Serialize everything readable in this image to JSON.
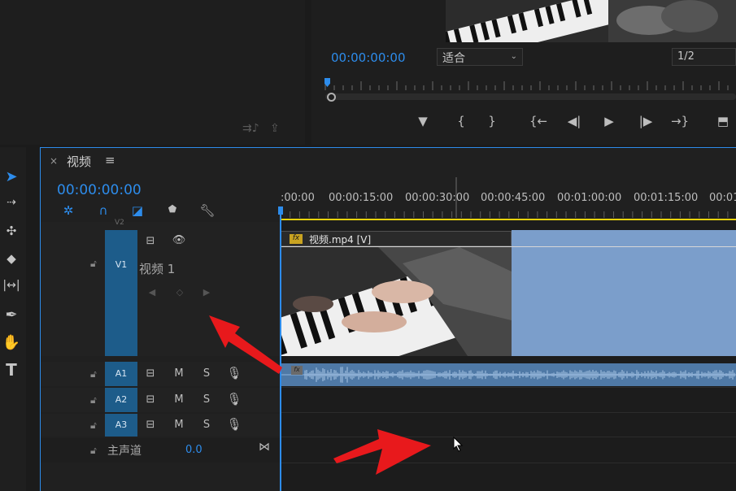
{
  "program_monitor": {
    "timecode": "00:00:00:00",
    "fit_value": "适合",
    "resolution_value": "1/2",
    "controls": [
      {
        "name": "add-marker-button",
        "glyph": "▼"
      },
      {
        "name": "mark-in-button",
        "glyph": "{"
      },
      {
        "name": "mark-out-button",
        "glyph": "}"
      },
      {
        "name": "go-to-in-button",
        "glyph": "{←"
      },
      {
        "name": "step-back-button",
        "glyph": "◀|"
      },
      {
        "name": "play-button",
        "glyph": "▶"
      },
      {
        "name": "step-forward-button",
        "glyph": "|▶"
      },
      {
        "name": "go-to-out-button",
        "glyph": "→}"
      },
      {
        "name": "lift-button",
        "glyph": "⬒"
      }
    ]
  },
  "timeline": {
    "close": "×",
    "title": "视频",
    "menu": "≡",
    "timecode": "00:00:00:00",
    "ruler_labels": [
      ":00:00",
      "00:00:15:00",
      "00:00:30:00",
      "00:00:45:00",
      "00:01:00:00",
      "00:01:15:00",
      "00:01"
    ],
    "tracks": {
      "v2_label": "V2",
      "v1": {
        "target": "V1",
        "name": "视频 1"
      },
      "audio": [
        {
          "target": "A1",
          "mute": "M",
          "solo": "S"
        },
        {
          "target": "A2",
          "mute": "M",
          "solo": "S"
        },
        {
          "target": "A3",
          "mute": "M",
          "solo": "S"
        }
      ],
      "master": {
        "label": "主声道",
        "value": "0.0"
      }
    },
    "video_clip": {
      "fx": "fx",
      "name": "视频.mp4 [V]"
    },
    "audio_clip": {
      "fx": "fx"
    }
  },
  "colors": {
    "accent": "#2d8ceb",
    "track_target": "#1d5c8a",
    "clip_video": "#7b9ecb",
    "clip_audio": "#4f79a6",
    "annotation_arrow": "#e8191c",
    "work_area_bar": "#e8d30c"
  },
  "icons": {
    "tools": [
      "selection-tool-icon",
      "track-select-tool-icon",
      "ripple-edit-tool-icon",
      "razor-tool-icon",
      "slip-tool-icon",
      "pen-tool-icon",
      "hand-tool-icon",
      "type-tool-icon"
    ]
  }
}
